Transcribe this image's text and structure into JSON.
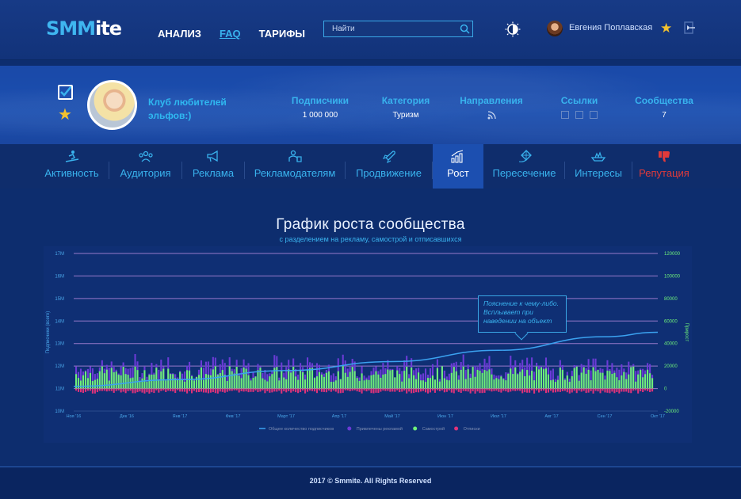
{
  "header": {
    "logo_main": "SMM",
    "logo_suffix": "ite",
    "nav": [
      "АНАЛИЗ",
      "FAQ",
      "ТАРИФЫ"
    ],
    "search_placeholder": "Найти",
    "username": "Евгения Поплавская"
  },
  "profile": {
    "club_name": "Клуб любителей эльфов:)",
    "stats": {
      "subscribers_label": "Подписчики",
      "subscribers_value": "1 000 000",
      "category_label": "Категория",
      "category_value": "Туризм",
      "directions_label": "Направления",
      "links_label": "Ссылки",
      "communities_label": "Сообщества",
      "communities_value": "7"
    }
  },
  "tabs": [
    {
      "label": "Активность",
      "icon": "surf-icon"
    },
    {
      "label": "Аудитория",
      "icon": "audience-icon"
    },
    {
      "label": "Реклама",
      "icon": "megaphone-icon"
    },
    {
      "label": "Рекламодателям",
      "icon": "advertiser-icon"
    },
    {
      "label": "Продвижение",
      "icon": "rocket-icon"
    },
    {
      "label": "Рост",
      "icon": "growth-chart-icon",
      "active": true
    },
    {
      "label": "Пересечение",
      "icon": "kite-icon"
    },
    {
      "label": "Интересы",
      "icon": "boat-icon"
    },
    {
      "label": "Репутация",
      "icon": "thumbs-down-icon",
      "color": "#e03a3a"
    }
  ],
  "chart_title": "График роста сообщества",
  "chart_subtitle": "с разделением на рекламу, самострой и отписавшихся",
  "tooltip_text": "Пояснение к чему-либо. Всплывает при наведении на объект",
  "chart_data": {
    "type": "bar",
    "left_axis": {
      "label": "Подписчики (всего)",
      "ticks": [
        "10M",
        "11M",
        "12M",
        "13M",
        "14M",
        "15M",
        "16M",
        "17M"
      ],
      "range": [
        10,
        17
      ]
    },
    "right_axis": {
      "label": "Прирост",
      "ticks": [
        "-20000",
        "0",
        "20000",
        "40000",
        "60000",
        "80000",
        "100000",
        "120000"
      ],
      "range": [
        -20000,
        120000
      ]
    },
    "x_ticks": [
      "Ноя '16",
      "Дек '16",
      "Янв '17",
      "Фев '17",
      "Март '17",
      "Апр '17",
      "Май '17",
      "Июн '17",
      "Июл '17",
      "Авг '17",
      "Сен '17",
      "Окт '17"
    ],
    "grid": true,
    "legend": [
      {
        "name": "Общее количество подписчиков",
        "color": "#3ba2f0"
      },
      {
        "name": "Привлечены рекламой",
        "color": "#6b3bd6"
      },
      {
        "name": "Самострой",
        "color": "#6ef07a"
      },
      {
        "name": "Отписки",
        "color": "#e0337a"
      }
    ],
    "legend_position": "bottom",
    "total_line": {
      "x": [
        "Ноя '16",
        "Янв '17",
        "Март '17",
        "Май '17",
        "Июл '17",
        "Сен '17",
        "Окт '17"
      ],
      "y": [
        11.1,
        11.4,
        11.8,
        12.2,
        12.7,
        13.3,
        13.5
      ]
    }
  },
  "footer_text": "2017 © Smmite. All Rights Reserved"
}
